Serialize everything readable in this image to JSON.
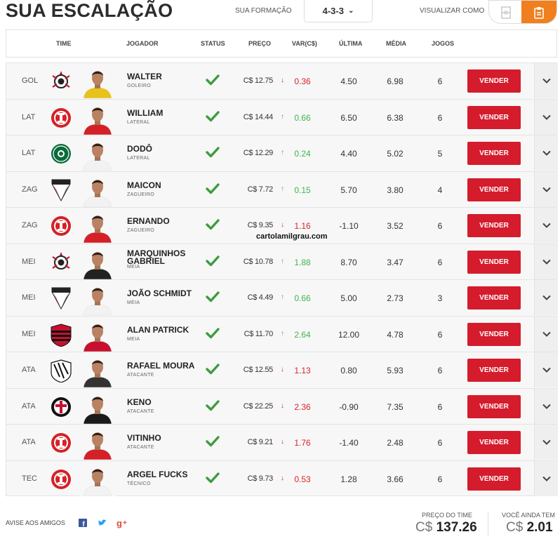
{
  "page": {
    "title": "SUA ESCALAÇÃO",
    "formation_label": "SUA FORMAÇÃO",
    "formation_value": "4-3-3",
    "view_label": "VISUALIZAR COMO"
  },
  "columns": {
    "time": "TIME",
    "jogador": "JOGADOR",
    "status": "STATUS",
    "preco": "PREÇO",
    "var": "VAR(C$)",
    "ultima": "ÚLTIMA",
    "media": "MÉDIA",
    "jogos": "JOGOS"
  },
  "sell_label": "VENDER",
  "players": [
    {
      "pos": "GOL",
      "team": "corinthians",
      "name": "WALTER",
      "role": "GOLEIRO",
      "price": "C$ 12.75",
      "var": "0.36",
      "trend": "down",
      "last": "4.50",
      "avg": "6.98",
      "games": "6",
      "shirt": "#e8c21a"
    },
    {
      "pos": "LAT",
      "team": "internacional",
      "name": "WILLIAM",
      "role": "LATERAL",
      "price": "C$ 14.44",
      "var": "0.66",
      "trend": "up",
      "last": "6.50",
      "avg": "6.38",
      "games": "6",
      "shirt": "#d62027"
    },
    {
      "pos": "LAT",
      "team": "coritiba",
      "name": "DODÔ",
      "role": "LATERAL",
      "price": "C$ 12.29",
      "var": "0.24",
      "trend": "up",
      "last": "4.40",
      "avg": "5.02",
      "games": "5",
      "shirt": "#f2f2f2"
    },
    {
      "pos": "ZAG",
      "team": "saopaulo",
      "name": "MAICON",
      "role": "ZAGUEIRO",
      "price": "C$ 7.72",
      "var": "0.15",
      "trend": "up",
      "last": "5.70",
      "avg": "3.80",
      "games": "4",
      "shirt": "#f2f2f2"
    },
    {
      "pos": "ZAG",
      "team": "internacional",
      "name": "ERNANDO",
      "role": "ZAGUEIRO",
      "price": "C$ 9.35",
      "var": "1.16",
      "trend": "down",
      "last": "-1.10",
      "avg": "3.52",
      "games": "6",
      "shirt": "#d62027"
    },
    {
      "pos": "MEI",
      "team": "corinthians",
      "name": "MARQUINHOS GABRIEL",
      "role": "MEIA",
      "price": "C$ 10.78",
      "var": "1.88",
      "trend": "up",
      "last": "8.70",
      "avg": "3.47",
      "games": "6",
      "shirt": "#222222"
    },
    {
      "pos": "MEI",
      "team": "saopaulo",
      "name": "JOÃO SCHMIDT",
      "role": "MEIA",
      "price": "C$ 4.49",
      "var": "0.66",
      "trend": "up",
      "last": "5.00",
      "avg": "2.73",
      "games": "3",
      "shirt": "#f2f2f2"
    },
    {
      "pos": "MEI",
      "team": "flamengo",
      "name": "ALAN PATRICK",
      "role": "MEIA",
      "price": "C$ 11.70",
      "var": "2.64",
      "trend": "up",
      "last": "12.00",
      "avg": "4.78",
      "games": "6",
      "shirt": "#c8102e"
    },
    {
      "pos": "ATA",
      "team": "figueirense",
      "name": "RAFAEL MOURA",
      "role": "ATACANTE",
      "price": "C$ 12.55",
      "var": "1.13",
      "trend": "down",
      "last": "0.80",
      "avg": "5.93",
      "games": "6",
      "shirt": "#333333"
    },
    {
      "pos": "ATA",
      "team": "santacruz",
      "name": "KENO",
      "role": "ATACANTE",
      "price": "C$ 22.25",
      "var": "2.36",
      "trend": "down",
      "last": "-0.90",
      "avg": "7.35",
      "games": "6",
      "shirt": "#1a1a1a"
    },
    {
      "pos": "ATA",
      "team": "internacional",
      "name": "VITINHO",
      "role": "ATACANTE",
      "price": "C$ 9.21",
      "var": "1.76",
      "trend": "down",
      "last": "-1.40",
      "avg": "2.48",
      "games": "6",
      "shirt": "#d62027"
    },
    {
      "pos": "TEC",
      "team": "internacional",
      "name": "ARGEL FUCKS",
      "role": "TÉCNICO",
      "price": "C$ 9.73",
      "var": "0.53",
      "trend": "down",
      "last": "1.28",
      "avg": "3.66",
      "games": "6",
      "shirt": "#f2f2f2"
    }
  ],
  "watermark": "cartolamilgrau.com",
  "footer": {
    "share_label": "AVISE AOS AMIGOS",
    "team_price_label": "PREÇO DO TIME",
    "team_price_currency": "C$",
    "team_price_value": "137.26",
    "remaining_label": "VOCÊ AINDA TEM",
    "remaining_currency": "C$",
    "remaining_value": "2.01"
  },
  "colors": {
    "accent": "#f07f1d",
    "sell": "#d41c2c",
    "up": "#3fb549",
    "down": "#d9242b"
  }
}
